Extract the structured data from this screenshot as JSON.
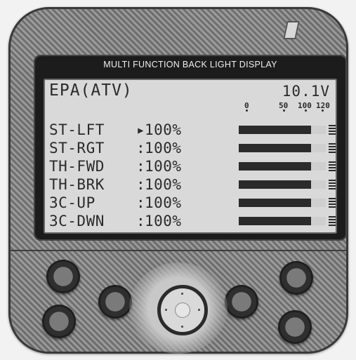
{
  "panel": {
    "header": "MULTI  FUNCTION  BACK  LIGHT  DISPLAY"
  },
  "lcd": {
    "title": "EPA(ATV)",
    "value": "10.1V",
    "scale_labels": [
      "0",
      "50",
      "100",
      "120"
    ]
  },
  "rows": [
    {
      "label": "ST-LFT",
      "sep": "▸",
      "value": "100%",
      "fill_percent": 100
    },
    {
      "label": "ST-RGT",
      "sep": ":",
      "value": "100%",
      "fill_percent": 100
    },
    {
      "label": "TH-FWD",
      "sep": ":",
      "value": "100%",
      "fill_percent": 100
    },
    {
      "label": "TH-BRK",
      "sep": ":",
      "value": "100%",
      "fill_percent": 100
    },
    {
      "label": "3C-UP ",
      "sep": ":",
      "value": "100%",
      "fill_percent": 100
    },
    {
      "label": "3C-DWN",
      "sep": ":",
      "value": "100%",
      "fill_percent": 100
    }
  ],
  "colors": {
    "lcd_background": "#d9d9d9",
    "lcd_ink": "#2a2a2a",
    "bezel": "#1c1c1c"
  }
}
